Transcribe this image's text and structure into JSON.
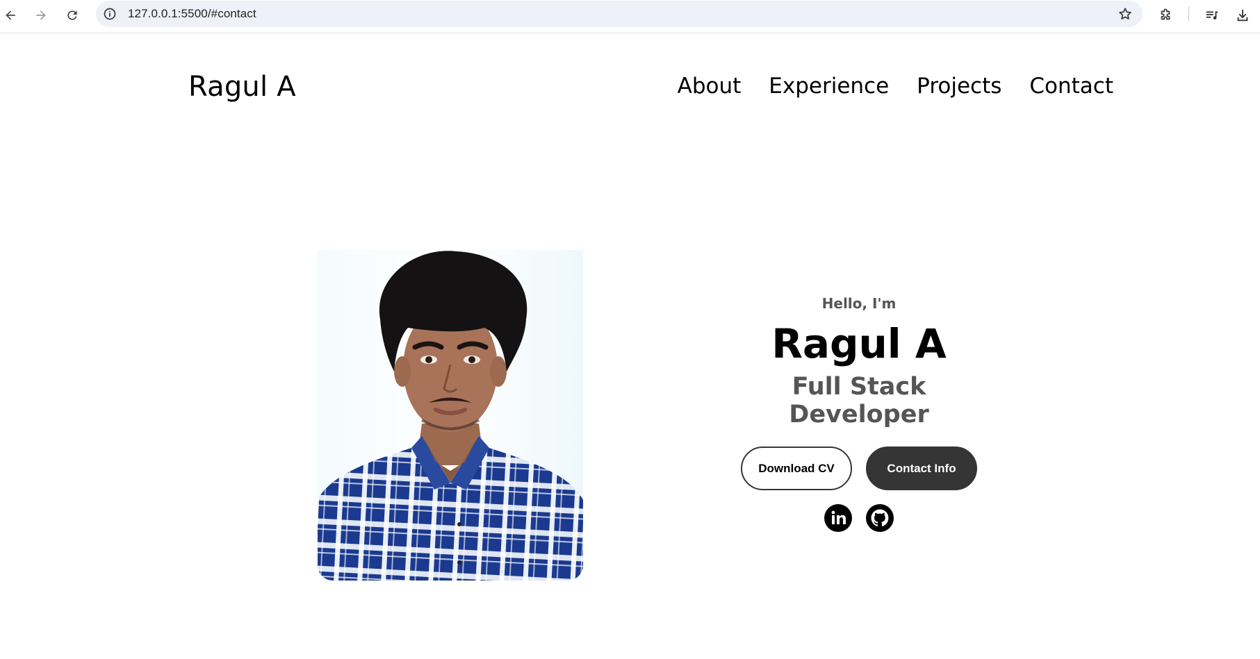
{
  "browser": {
    "url": "127.0.0.1:5500/#contact"
  },
  "header": {
    "logo": "Ragul A",
    "nav": [
      "About",
      "Experience",
      "Projects",
      "Contact"
    ]
  },
  "hero": {
    "greeting": "Hello, I'm",
    "name": "Ragul A",
    "role": "Full Stack Developer",
    "buttons": {
      "download_cv": "Download CV",
      "contact_info": "Contact Info"
    },
    "socials": [
      "linkedin-icon",
      "github-icon"
    ]
  },
  "colors": {
    "text": "#000000",
    "muted": "#555555",
    "button_dark": "#353535",
    "shirt_blue": "#1b3a8f",
    "omnibox_bg": "#eef1f7"
  }
}
